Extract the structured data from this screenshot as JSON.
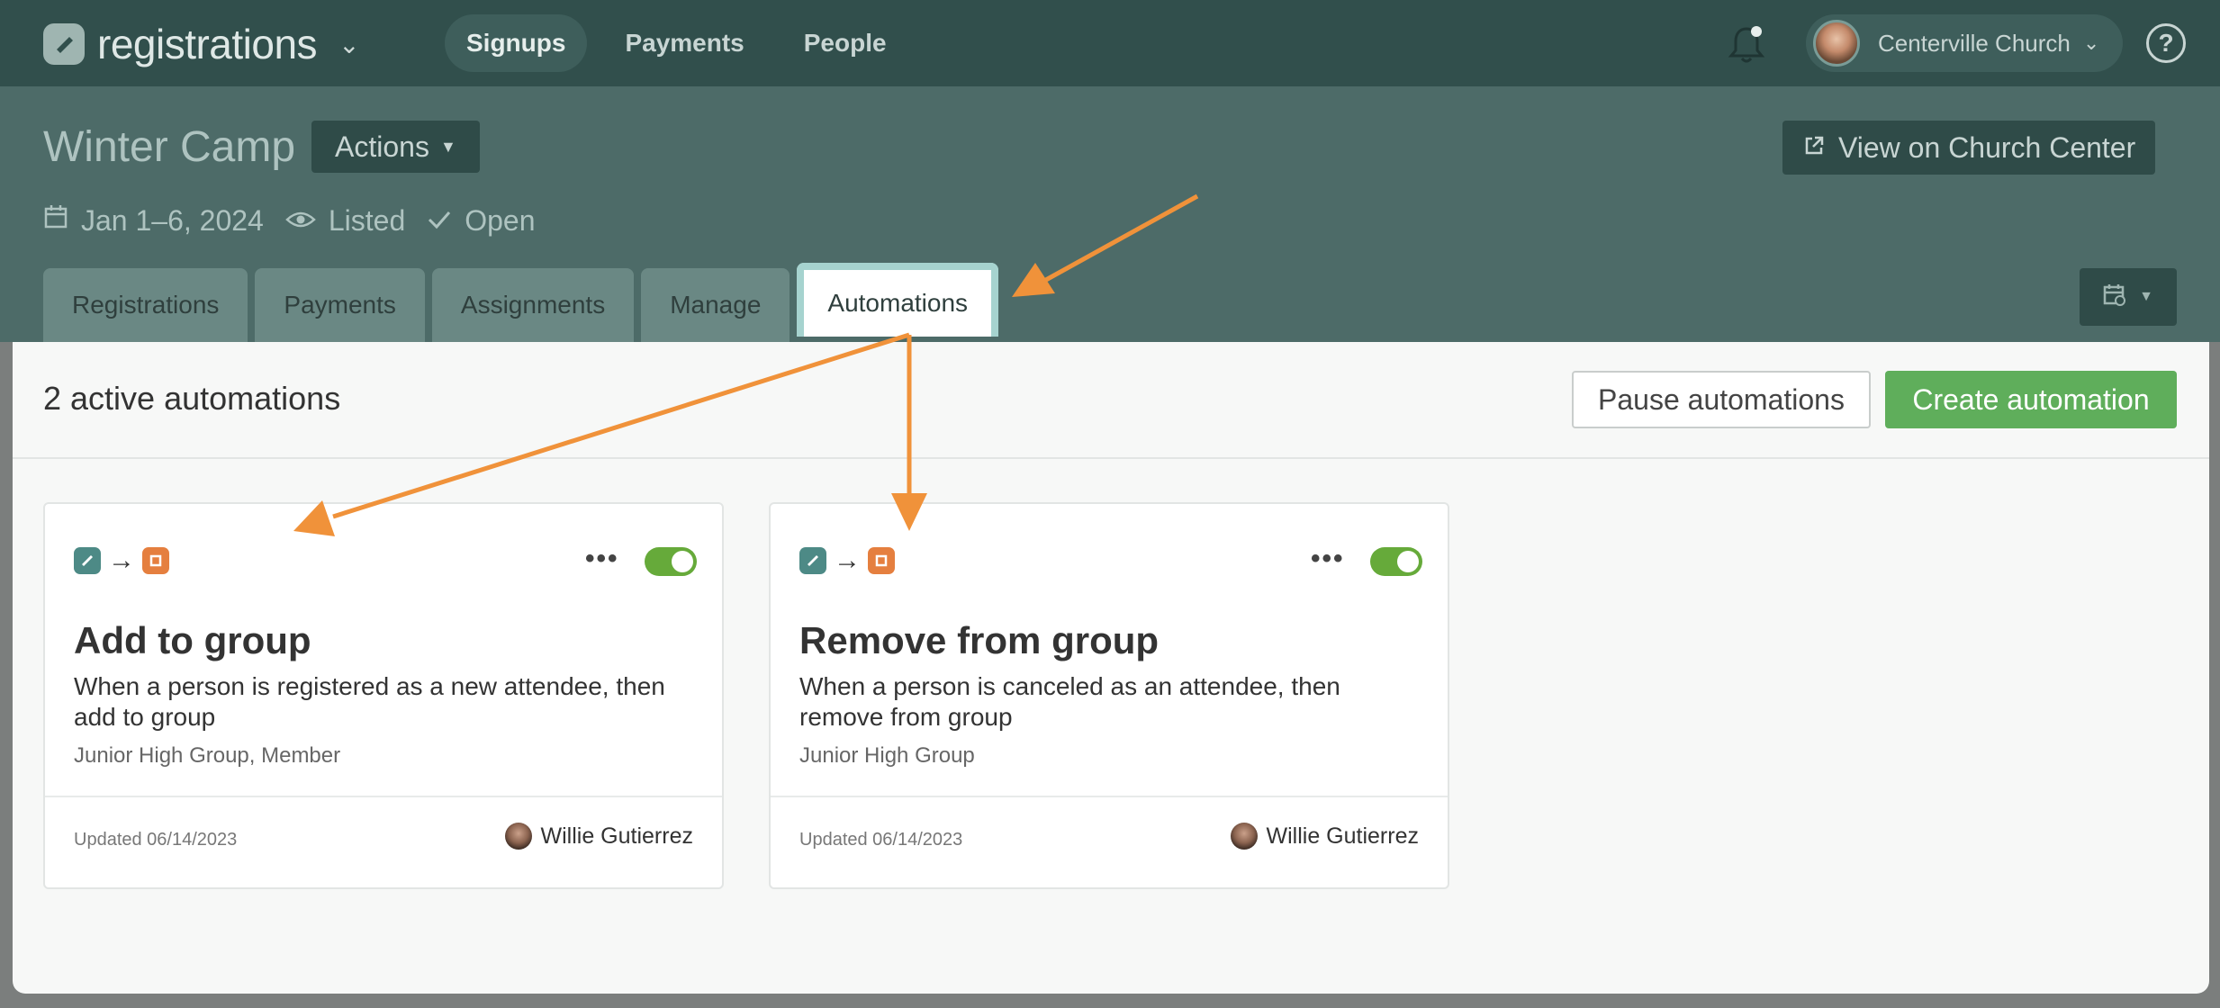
{
  "app": {
    "name": "registrations"
  },
  "nav": {
    "items": [
      "Signups",
      "Payments",
      "People"
    ],
    "active": "Signups"
  },
  "org": {
    "name": "Centerville Church"
  },
  "event": {
    "title": "Winter Camp",
    "actions_label": "Actions",
    "view_label": "View on Church Center",
    "dates": "Jan 1–6, 2024",
    "visibility": "Listed",
    "status": "Open"
  },
  "tabs": [
    "Registrations",
    "Payments",
    "Assignments",
    "Manage",
    "Automations"
  ],
  "active_tab": "Automations",
  "automations": {
    "count_label": "2 active automations",
    "pause_label": "Pause automations",
    "create_label": "Create automation",
    "cards": [
      {
        "title": "Add to group",
        "description": "When a person is registered as a new attendee, then add to group",
        "details": "Junior High Group, Member",
        "updated": "Updated 06/14/2023",
        "user": "Willie Gutierrez",
        "enabled": true
      },
      {
        "title": "Remove from group",
        "description": "When a person is canceled as an attendee, then remove from group",
        "details": "Junior High Group",
        "updated": "Updated 06/14/2023",
        "user": "Willie Gutierrez",
        "enabled": true
      }
    ]
  },
  "colors": {
    "topbar": "#314f4c",
    "header": "#4d6b68",
    "create_button": "#5fae5b",
    "toggle_on": "#66aa3a",
    "annotation_arrow": "#f0923a"
  }
}
